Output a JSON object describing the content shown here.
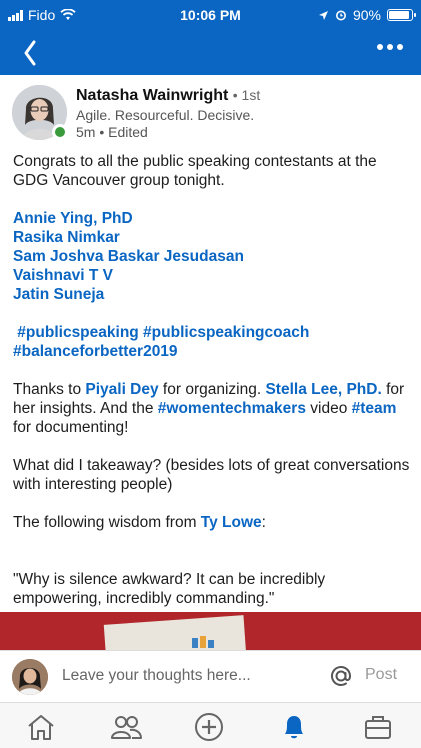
{
  "status_bar": {
    "carrier": "Fido",
    "time": "10:06 PM",
    "battery": "90%",
    "battery_level": 0.9
  },
  "nav": {
    "back_icon": "chevron-left-icon",
    "more_icon": "more-dots-icon"
  },
  "post": {
    "author_name": "Natasha Wainwright",
    "degree": "• 1st",
    "headline": "Agile. Resourceful. Decisive.",
    "meta": "5m • Edited",
    "intro": "Congrats to all the public speaking contestants at the GDG Vancouver group tonight.",
    "mentions": [
      "Annie Ying, PhD",
      "Rasika Nimkar",
      "Sam Joshva Baskar Jesudasan",
      "Vaishnavi T V",
      "Jatin Suneja"
    ],
    "hashtags_line1": " #publicspeaking #publicspeakingcoach",
    "hashtags_line2": "#balanceforbetter2019",
    "thanks": {
      "t1": "Thanks to ",
      "l1": "Piyali Dey",
      "t2": " for organizing. ",
      "l2": "Stella Lee, PhD.",
      "t3": " for her insights. And the ",
      "l3": "#womentechmakers",
      "t4": " video ",
      "l4": "#team",
      "t5": " for documenting!"
    },
    "takeaway": "What did I takeaway? (besides lots of great conversations with interesting people)",
    "wisdom": {
      "t1": "The following wisdom from ",
      "l1": "Ty Lowe",
      "t2": ":"
    },
    "quote": "\"Why is silence awkward? It can be incredibly empowering, incredibly commanding.\""
  },
  "comment": {
    "placeholder": "Leave your thoughts here...",
    "post_label": "Post",
    "mention_icon": "at-sign-icon"
  },
  "tabs": [
    {
      "icon": "home-icon"
    },
    {
      "icon": "my-network-icon"
    },
    {
      "icon": "post-plus-icon"
    },
    {
      "icon": "notifications-bell-icon",
      "active": true
    },
    {
      "icon": "jobs-briefcase-icon"
    }
  ],
  "colors": {
    "brand_blue": "#0a66c2",
    "presence_green": "#3a9b3a",
    "link_blue": "#0a66c2"
  }
}
